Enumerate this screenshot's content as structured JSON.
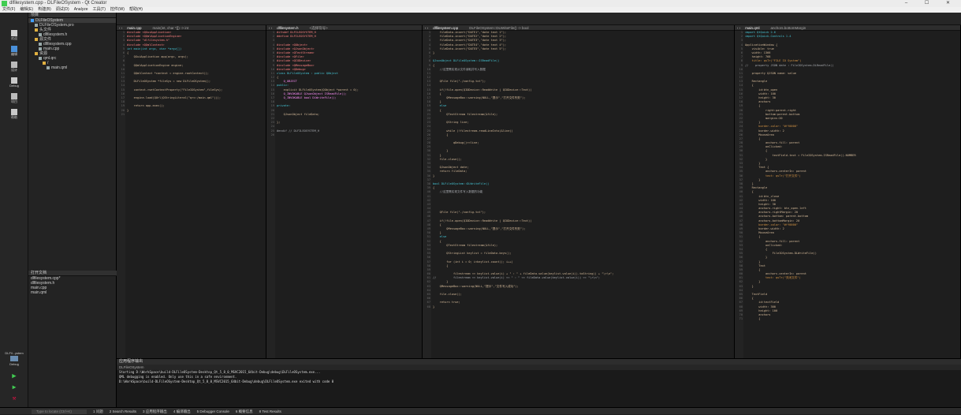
{
  "window": {
    "title": "dlfilesystem.cpp - DLFileOSystem - Qt Creator",
    "controls": "–  ☐  ✕"
  },
  "menu": [
    "文件(F)",
    "编辑(E)",
    "构建(B)",
    "调试(D)",
    "Analyze",
    "工具(T)",
    "控件(W)",
    "帮助(H)"
  ],
  "modes": [
    {
      "label": "欢迎"
    },
    {
      "label": "编辑"
    },
    {
      "label": "设计"
    },
    {
      "label": "Debug"
    },
    {
      "label": "项目"
    },
    {
      "label": "帮助"
    }
  ],
  "kit": {
    "name": "DLFil...ystem",
    "sub": "Debug"
  },
  "projects": {
    "header": "项目",
    "tree": [
      {
        "label": "DLFileOSystem",
        "level": 0,
        "type": "proj"
      },
      {
        "label": "DLFileOSystem.pro",
        "level": 1,
        "type": "file"
      },
      {
        "label": "头文件",
        "level": 1,
        "type": "folder"
      },
      {
        "label": "dlfilesystem.h",
        "level": 2,
        "type": "file"
      },
      {
        "label": "源文件",
        "level": 1,
        "type": "folder"
      },
      {
        "label": "dlfilesystem.cpp",
        "level": 2,
        "type": "file"
      },
      {
        "label": "main.cpp",
        "level": 2,
        "type": "file"
      },
      {
        "label": "资源",
        "level": 1,
        "type": "folder"
      },
      {
        "label": "qml.qrc",
        "level": 2,
        "type": "file"
      },
      {
        "label": "/",
        "level": 3,
        "type": "folder"
      },
      {
        "label": "main.qml",
        "level": 4,
        "type": "file"
      }
    ]
  },
  "open_docs": {
    "header": "打开文档",
    "items": [
      "dlfilesystem.cpp*",
      "dlfilesystem.h",
      "main.cpp",
      "main.qml"
    ]
  },
  "editors": [
    {
      "tab": "main.cpp",
      "sym": "main(int, char *[]) -> int",
      "lines": [
        [
          "p",
          "#include <QGuiApplication>"
        ],
        [
          "p",
          "#include <QQmlApplicationEngine>"
        ],
        [
          "p",
          "#include \"dlfilesystem.h\""
        ],
        [
          "p",
          "#include <QQmlContext>"
        ],
        [
          "k",
          "int main(int argc, char *argv[])"
        ],
        [
          "t",
          "{"
        ],
        [
          "t",
          "    QGuiApplication app(argc, argv);"
        ],
        [
          "t",
          ""
        ],
        [
          "t",
          "    QQmlApplicationEngine engine;"
        ],
        [
          "t",
          ""
        ],
        [
          "t",
          "    QQmlContext *context = engine.rootContext();"
        ],
        [
          "t",
          ""
        ],
        [
          "t",
          "    DLFileOSystem *fileSys = new DLFileOSystem();"
        ],
        [
          "t",
          ""
        ],
        [
          "t",
          "    context->setContextProperty(\"FileIOSystem\",fileSys);"
        ],
        [
          "t",
          ""
        ],
        [
          "t",
          "    engine.load(QUrl(QStringLiteral(\"qrc:/main.qml\")));"
        ],
        [
          "t",
          ""
        ],
        [
          "t",
          "    return app.exec();"
        ],
        [
          "t",
          "}"
        ],
        [
          "t",
          ""
        ]
      ]
    },
    {
      "tab": "dlfilesystem.h",
      "sym": "<选择符号>",
      "lines": [
        [
          "p",
          "#ifndef DLFILEOSYSTEM_H"
        ],
        [
          "p",
          "#define DLFILEOSYSTEM_H"
        ],
        [
          "t",
          ""
        ],
        [
          "p",
          "#include <QObject>"
        ],
        [
          "p",
          "#include <QJsonObject>"
        ],
        [
          "p",
          "#include <QTextStream>"
        ],
        [
          "p",
          "#include <QFile>"
        ],
        [
          "p",
          "#include <QIODevice>"
        ],
        [
          "p",
          "#include <QMessageBox>"
        ],
        [
          "p",
          "#include <QDebug>"
        ],
        [
          "k",
          "class DLFileOSystem : public QObject"
        ],
        [
          "t",
          "{"
        ],
        [
          "f",
          "    Q_OBJECT"
        ],
        [
          "k",
          "public:"
        ],
        [
          "t",
          "    explicit DLFileOSystem(QObject *parent = 0);"
        ],
        [
          "f",
          "    Q_INVOKABLE QJsonObject ISReadFile();"
        ],
        [
          "f",
          "    Q_INVOKABLE bool DLWriteFile();"
        ],
        [
          "t",
          ""
        ],
        [
          "k",
          "private:"
        ],
        [
          "t",
          ""
        ],
        [
          "t",
          "    QJsonObject fileData;"
        ],
        [
          "t",
          ""
        ],
        [
          "t",
          "};"
        ],
        [
          "t",
          ""
        ],
        [
          "c",
          "#endif // DLFILEOSYSTEM_H"
        ],
        [
          "t",
          ""
        ]
      ]
    },
    {
      "tab": "dlfilesystem.cpp",
      "sym": "DLFileOSystem::DLWriteFile() -> bool",
      "lines": [
        [
          "t",
          "    fileData.insert(\"DATE1\",\"date text 1\");"
        ],
        [
          "t",
          "    fileData.insert(\"DATE2\",\"date text 2\");"
        ],
        [
          "t",
          "    fileData.insert(\"DATE3\",\"date text 3\");"
        ],
        [
          "t",
          "    fileData.insert(\"DATE4\",\"date text 4\");"
        ],
        [
          "t",
          "    fileData.insert(\"DATE5\",\"date text 5\");"
        ],
        [
          "t",
          "}"
        ],
        [
          "t",
          ""
        ],
        [
          "k",
          "QJsonObject DLFileOSystem::ISReadFile()"
        ],
        [
          "t",
          "{"
        ],
        [
          "c",
          "    //这里需实现从文件读取并写入数据"
        ],
        [
          "t",
          ""
        ],
        [
          "t",
          ""
        ],
        [
          "t",
          "    QFile file(\"./config.txt\");"
        ],
        [
          "t",
          ""
        ],
        [
          "t",
          "    if(!file.open(QIODevice::ReadWrite | QIODevice::Text))"
        ],
        [
          "t",
          "    {"
        ],
        [
          "t",
          "        QMessageBox::warning(NULL,\"提示\",\"打开文件失败\");"
        ],
        [
          "t",
          "    }"
        ],
        [
          "k",
          "    else"
        ],
        [
          "t",
          "    {"
        ],
        [
          "t",
          "        QTextStream filestream(&file);"
        ],
        [
          "t",
          ""
        ],
        [
          "t",
          "        QString line;"
        ],
        [
          "t",
          ""
        ],
        [
          "t",
          "        while (!filestream.readLineInto(&line))"
        ],
        [
          "t",
          "        {"
        ],
        [
          "t",
          ""
        ],
        [
          "t",
          "            qDebug()<<line;"
        ],
        [
          "t",
          ""
        ],
        [
          "t",
          "        }"
        ],
        [
          "t",
          "    }"
        ],
        [
          "t",
          "    file.close();"
        ],
        [
          "t",
          ""
        ],
        [
          "t",
          "    QJsonObject date;"
        ],
        [
          "t",
          "    return fileData;"
        ],
        [
          "t",
          "}"
        ],
        [
          "t",
          ""
        ],
        [
          "k",
          "bool DLFileOSystem::DLWriteFile()"
        ],
        [
          "t",
          "{"
        ],
        [
          "c",
          "    //这里需实现文件写入数据的功能"
        ],
        [
          "t",
          ""
        ],
        [
          "t",
          ""
        ],
        [
          "t",
          ""
        ],
        [
          "t",
          ""
        ],
        [
          "t",
          "    QFile file(\"./config.txt\");"
        ],
        [
          "t",
          ""
        ],
        [
          "t",
          "    if(!file.open(QIODevice::ReadWrite | QIODevice::Text))"
        ],
        [
          "t",
          "    {"
        ],
        [
          "t",
          "        QMessageBox::warning(NULL,\"提示\",\"打开文件失败\");"
        ],
        [
          "t",
          "    }"
        ],
        [
          "k",
          "    else"
        ],
        [
          "t",
          "    {"
        ],
        [
          "t",
          "        QTextStream filestream(&file);"
        ],
        [
          "t",
          ""
        ],
        [
          "t",
          "        QStringList keylist = fileData.keys();"
        ],
        [
          "t",
          ""
        ],
        [
          "t",
          "        for (int i = 0; i<keylist.count(); i++)"
        ],
        [
          "t",
          "        {"
        ],
        [
          "t",
          ""
        ],
        [
          "t",
          "            filestream << keylist.value(i) + \" : \" + fileData.value(keylist.value(i)).toString() + \"\\r\\n\";"
        ],
        [
          "c",
          "//          filestream << keylist.value(i) << \" : \" << fileData.value(keylist.value(i)) << \"\\r\\n\";"
        ],
        [
          "t",
          "        }"
        ],
        [
          "t",
          "    QMessageBox::warning(NULL,\"提示\",\"文件写入成功\");"
        ],
        [
          "t",
          ""
        ],
        [
          "t",
          "    file.close();"
        ],
        [
          "t",
          ""
        ],
        [
          "t",
          "    return true;"
        ],
        [
          "t",
          "}"
        ]
      ]
    },
    {
      "tab": "main.qml",
      "sym": "anchors.bottomMargin",
      "lines": [
        [
          "k",
          "import QtQuick 2.6"
        ],
        [
          "k",
          "import QtQuick.Controls 1.4"
        ],
        [
          "t",
          ""
        ],
        [
          "t",
          "ApplicationWindow {"
        ],
        [
          "t",
          "    visible: true"
        ],
        [
          "t",
          "    width: 1366"
        ],
        [
          "t",
          "    height: 768"
        ],
        [
          "s",
          "    title: qsTr(\"FILE IO System\")"
        ],
        [
          "c",
          "//    property JSON date : FileIOSystem.DLReadFile()"
        ],
        [
          "t",
          ""
        ],
        [
          "t",
          "    property QJSON name: value"
        ],
        [
          "t",
          ""
        ],
        [
          "t",
          "    Rectangle"
        ],
        [
          "t",
          "    {"
        ],
        [
          "t",
          "        id:btn_open"
        ],
        [
          "t",
          "        width: 100"
        ],
        [
          "t",
          "        height: 30"
        ],
        [
          "t",
          "        anchors"
        ],
        [
          "t",
          "        {"
        ],
        [
          "t",
          "            right:parent.right"
        ],
        [
          "t",
          "            bottom:parent.bottom"
        ],
        [
          "t",
          "            margins:20"
        ],
        [
          "t",
          "        }"
        ],
        [
          "s",
          "        border.color: \"#ff0000\""
        ],
        [
          "t",
          "        border.width: 2"
        ],
        [
          "t",
          "        MouseArea"
        ],
        [
          "t",
          "        {"
        ],
        [
          "t",
          "            anchors.fill: parent"
        ],
        [
          "t",
          "            onClicked:"
        ],
        [
          "t",
          "            {"
        ],
        [
          "t",
          "                textField.text = FileIOSystem.ISReadFile().NUMBER"
        ],
        [
          "t",
          "            }"
        ],
        [
          "t",
          "        }"
        ],
        [
          "t",
          "        Text {"
        ],
        [
          "t",
          "            anchors.centerIn: parent"
        ],
        [
          "s",
          "            text: qsTr(\"打开文件\")"
        ],
        [
          "t",
          "        }"
        ],
        [
          "t",
          "    }"
        ],
        [
          "t",
          "    Rectangle"
        ],
        [
          "t",
          "    {"
        ],
        [
          "t",
          "        id:btn_close"
        ],
        [
          "t",
          "        width: 100"
        ],
        [
          "t",
          "        height: 30"
        ],
        [
          "t",
          "        anchors.right: btn_open.left"
        ],
        [
          "t",
          "        anchors.rightMargin: 20"
        ],
        [
          "t",
          "        anchors.bottom: parent.bottom"
        ],
        [
          "t",
          "        anchors.bottomMargin: 20"
        ],
        [
          "s",
          "        border.color: \"#ff0000\""
        ],
        [
          "t",
          "        border.width: 2"
        ],
        [
          "t",
          "        MouseArea"
        ],
        [
          "t",
          "        {"
        ],
        [
          "t",
          "            anchors.fill: parent"
        ],
        [
          "t",
          "            onClicked:"
        ],
        [
          "t",
          "            {"
        ],
        [
          "t",
          "                FileIOSystem.DLWriteFile()"
        ],
        [
          "t",
          "            }"
        ],
        [
          "t",
          "        }"
        ],
        [
          "t",
          "        Text"
        ],
        [
          "t",
          "        {"
        ],
        [
          "t",
          "            anchors.centerIn: parent"
        ],
        [
          "s",
          "            text: qsTr(\"关闭文件\")"
        ],
        [
          "t",
          "        }"
        ],
        [
          "t",
          "    }"
        ],
        [
          "t",
          ""
        ],
        [
          "t",
          "    TextField"
        ],
        [
          "t",
          "    {"
        ],
        [
          "t",
          "        id:textField"
        ],
        [
          "t",
          "        width: 300"
        ],
        [
          "t",
          "        height: 100"
        ],
        [
          "t",
          "        anchors"
        ],
        [
          "t",
          "        {"
        ]
      ]
    }
  ],
  "output": {
    "header": "应用程序输出",
    "sub": "DLFileOSystem",
    "lines": [
      "Starting D:\\WorkSpace\\build-DLFileOSystem-Desktop_Qt_5_8_0_MSVC2015_64bit-Debug\\debug\\DLFileOSystem.exe...",
      "QML debugging is enabled. Only use this in a safe environment.",
      "D:\\WorkSpace\\build-DLFileOSystem-Desktop_Qt_5_8_0_MSVC2015_64bit-Debug\\debug\\DLFileOSystem.exe exited with code 0"
    ]
  },
  "status": {
    "locator": "Type to locate (Ctrl+K)",
    "panes": [
      "1 问题",
      "2 Search Results",
      "3 应用程序输出",
      "4 编译输出",
      "5 Debugger Console",
      "6 概要信息",
      "8 Test Results"
    ]
  },
  "colors": {
    "accent": "#41cd52",
    "background": "#1e1e1e"
  }
}
